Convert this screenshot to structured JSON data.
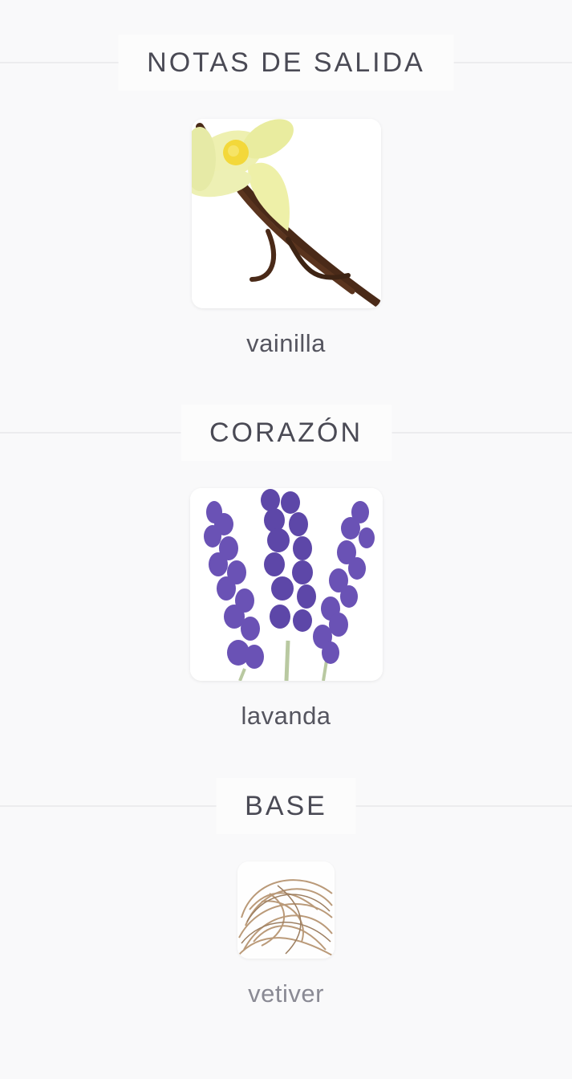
{
  "sections": [
    {
      "title": "NOTAS DE SALIDA",
      "note": {
        "label": "vainilla",
        "icon": "vanilla-flower-icon"
      }
    },
    {
      "title": "CORAZÓN",
      "note": {
        "label": "lavanda",
        "icon": "lavender-icon"
      }
    },
    {
      "title": "BASE",
      "note": {
        "label": "vetiver",
        "icon": "vetiver-root-icon"
      }
    }
  ],
  "colors": {
    "background": "#f9f9fa",
    "text": "#4a4a55",
    "divider": "#ececee",
    "lavender": "#6a4fb0",
    "vanilla_flower": "#f3efb3",
    "vanilla_pod": "#4a2a18",
    "vetiver": "#b08a63"
  }
}
